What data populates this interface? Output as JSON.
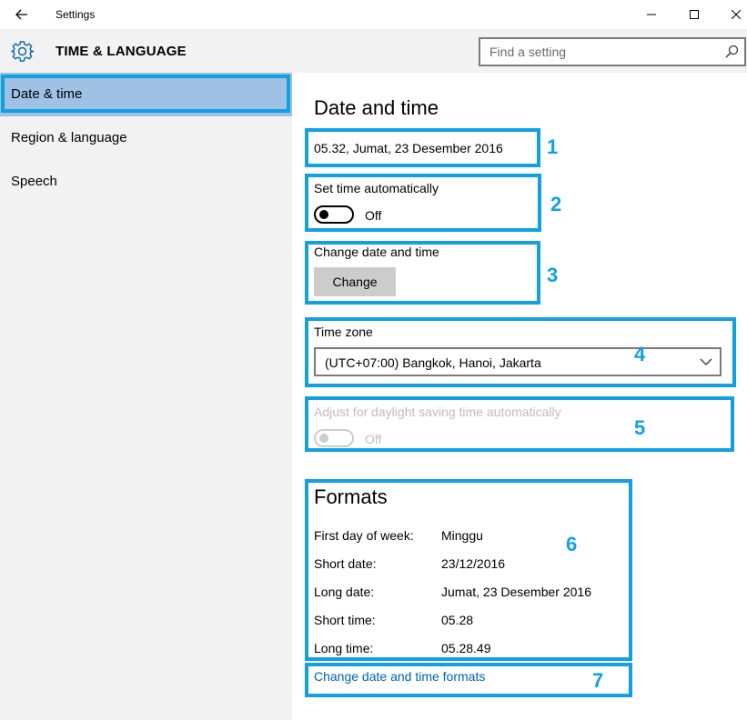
{
  "window": {
    "title": "Settings",
    "controls": {
      "minimize": "—",
      "maximize": "☐",
      "close": "✕"
    }
  },
  "header": {
    "icon": "gear-icon",
    "title": "TIME & LANGUAGE",
    "search": {
      "placeholder": "Find a setting",
      "value": ""
    }
  },
  "sidebar": {
    "items": [
      {
        "label": "Date & time",
        "active": true
      },
      {
        "label": "Region & language",
        "active": false
      },
      {
        "label": "Speech",
        "active": false
      }
    ]
  },
  "main": {
    "title": "Date and time",
    "current_datetime": "05.32, Jumat, 23 Desember 2016",
    "set_time_auto": {
      "label": "Set time automatically",
      "state": "Off"
    },
    "change_datetime": {
      "label": "Change date and time",
      "button": "Change"
    },
    "time_zone": {
      "label": "Time zone",
      "value": "(UTC+07:00) Bangkok, Hanoi, Jakarta"
    },
    "daylight": {
      "label": "Adjust for daylight saving time automatically",
      "state": "Off",
      "disabled": true
    },
    "formats": {
      "title": "Formats",
      "rows": [
        {
          "label": "First day of week:",
          "value": "Minggu"
        },
        {
          "label": "Short date:",
          "value": "23/12/2016"
        },
        {
          "label": "Long date:",
          "value": "Jumat, 23 Desember 2016"
        },
        {
          "label": "Short time:",
          "value": "05.28"
        },
        {
          "label": "Long time:",
          "value": "05.28.49"
        }
      ]
    },
    "change_formats_link": "Change date and time formats"
  },
  "annotations": [
    "1",
    "2",
    "3",
    "4",
    "5",
    "6",
    "7"
  ],
  "colors": {
    "annotation": "#11a0e0",
    "active_nav": "#9fc1e4",
    "sidebar_bg": "#f2f2f2",
    "link": "#0063b1"
  }
}
